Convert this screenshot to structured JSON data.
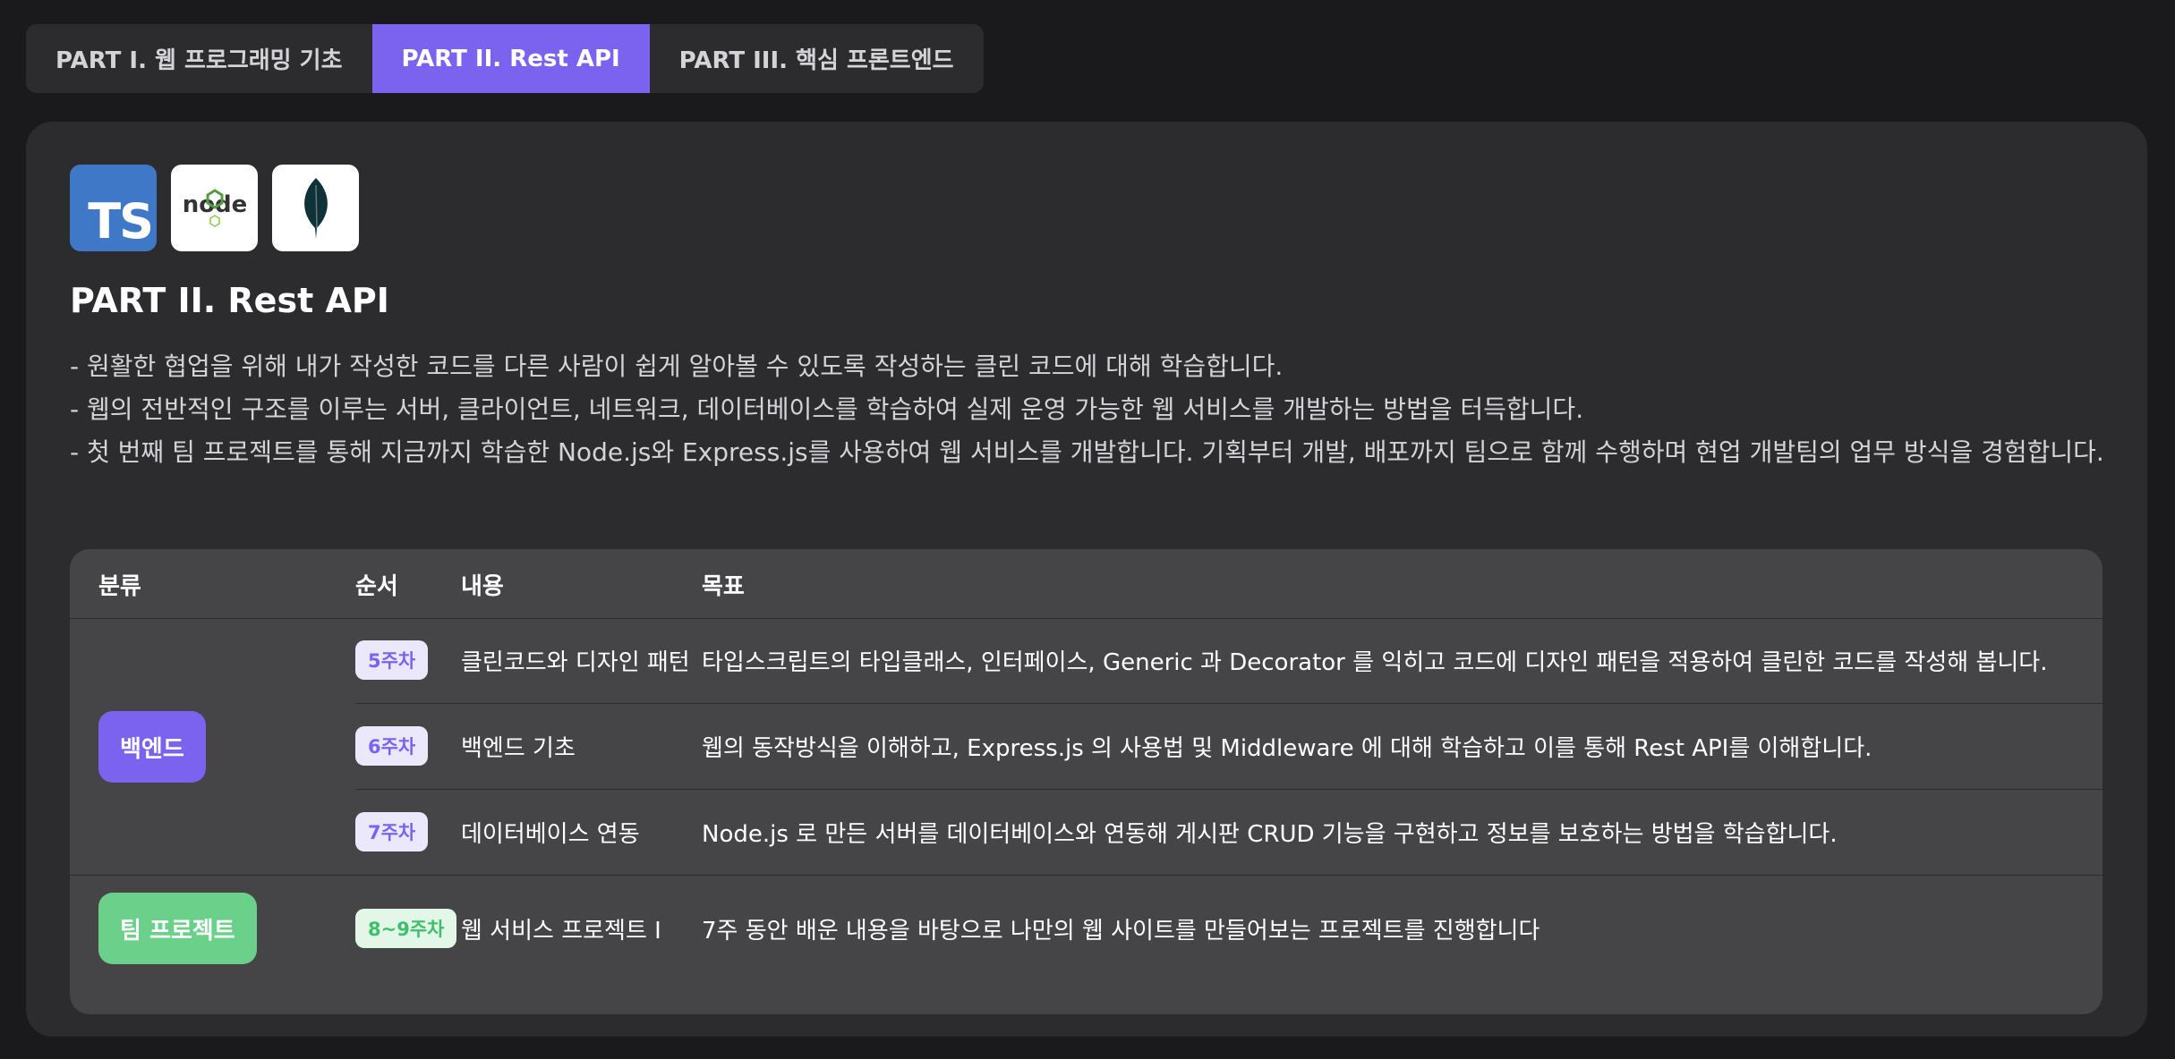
{
  "tabs": [
    {
      "label": "PART I. 웹 프로그래밍 기초",
      "active": false
    },
    {
      "label": "PART II. Rest API",
      "active": true
    },
    {
      "label": "PART III. 핵심 프론트엔드",
      "active": false
    }
  ],
  "logos": [
    {
      "name": "typescript-logo",
      "text": "TS",
      "color": "#3f78c6"
    },
    {
      "name": "nodejs-logo",
      "text": "node",
      "color": "#539e43"
    },
    {
      "name": "mongodb-logo",
      "text": "",
      "color": "#13aa52"
    }
  ],
  "section": {
    "title": "PART II. Rest API",
    "description": [
      "- 원활한 협업을 위해 내가 작성한 코드를 다른 사람이 쉽게 알아볼 수 있도록 작성하는 클린 코드에 대해 학습합니다.",
      "- 웹의 전반적인 구조를 이루는 서버, 클라이언트, 네트워크, 데이터베이스를 학습하여 실제 운영 가능한 웹 서비스를 개발하는 방법을 터득합니다.",
      "- 첫 번째 팀 프로젝트를 통해 지금까지 학습한 Node.js와 Express.js를 사용하여 웹 서비스를 개발합니다. 기획부터 개발, 배포까지 팀으로 함께 수행하며 현업 개발팀의 업무 방식을 경험합니다."
    ]
  },
  "table": {
    "headers": [
      "분류",
      "순서",
      "내용",
      "목표"
    ],
    "categories": [
      {
        "label": "백엔드",
        "color": "#7b63f0"
      },
      {
        "label": "팀 프로젝트",
        "color": "#6bd08a"
      }
    ],
    "rows": [
      {
        "week": "5주차",
        "content": "클린코드와 디자인 패턴",
        "goal": "타입스크립트의 타입클래스, 인터페이스, Generic 과 Decorator 를 익히고 코드에 디자인 패턴을 적용하여 클린한 코드를 작성해 봅니다."
      },
      {
        "week": "6주차",
        "content": "백엔드 기초",
        "goal": "웹의 동작방식을 이해하고, Express.js 의 사용법 및 Middleware 에 대해 학습하고 이를 통해 Rest API를 이해합니다."
      },
      {
        "week": "7주차",
        "content": "데이터베이스 연동",
        "goal": "Node.js 로 만든 서버를 데이터베이스와 연동해 게시판 CRUD 기능을 구현하고 정보를 보호하는 방법을 학습합니다."
      },
      {
        "week": "8~9주차",
        "content": "웹 서비스 프로젝트 I",
        "goal": "7주 동안 배운 내용을 바탕으로 나만의 웹 사이트를 만들어보는 프로젝트를 진행합니다"
      }
    ]
  },
  "colors": {
    "accent": "#7b63f0",
    "green": "#6bd08a",
    "background": "#1a1a1d",
    "card": "#2c2c2f",
    "table": "#454547"
  }
}
